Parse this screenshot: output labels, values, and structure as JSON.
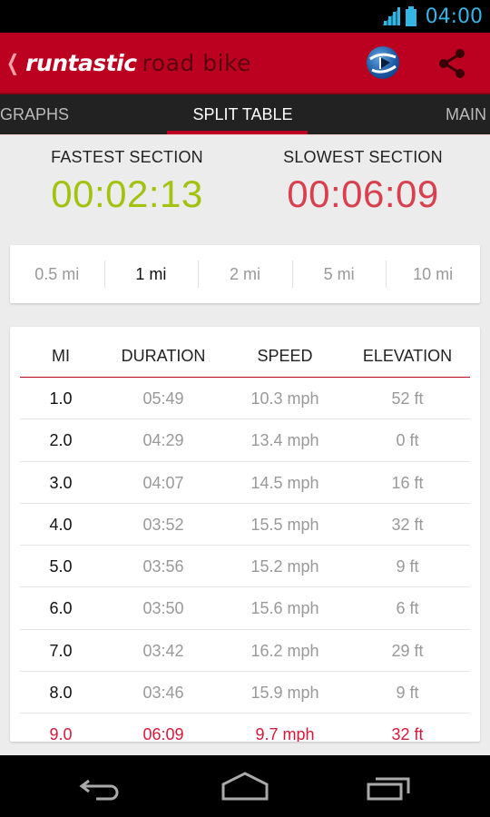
{
  "status_bar": {
    "time": "04:00",
    "icons": [
      "signal-icon",
      "battery-icon"
    ],
    "accent_color": "#33b5e5"
  },
  "action_bar": {
    "back_icon": "chevron-left-icon",
    "brand": "runtastic",
    "product": "road bike",
    "icons": [
      "runtastic-app-icon",
      "share-icon"
    ],
    "color": "#bb0020"
  },
  "tabs": [
    {
      "label": "GRAPHS",
      "active": false
    },
    {
      "label": "SPLIT TABLE",
      "active": true
    },
    {
      "label": "MAIN",
      "active": false
    }
  ],
  "summary": {
    "fastest": {
      "label": "FASTEST SECTION",
      "value": "00:02:13",
      "color": "#a2c20e"
    },
    "slowest": {
      "label": "SLOWEST SECTION",
      "value": "00:06:09",
      "color": "#d8404f"
    }
  },
  "intervals": [
    {
      "label": "0.5 mi",
      "active": false
    },
    {
      "label": "1 mi",
      "active": true
    },
    {
      "label": "2 mi",
      "active": false
    },
    {
      "label": "5 mi",
      "active": false
    },
    {
      "label": "10 mi",
      "active": false
    }
  ],
  "split_table": {
    "headers": [
      "MI",
      "DURATION",
      "SPEED",
      "ELEVATION"
    ],
    "rows": [
      [
        "1.0",
        "05:49",
        "10.3 mph",
        "52 ft"
      ],
      [
        "2.0",
        "04:29",
        "13.4 mph",
        "0 ft"
      ],
      [
        "3.0",
        "04:07",
        "14.5 mph",
        "16 ft"
      ],
      [
        "4.0",
        "03:52",
        "15.5 mph",
        "32 ft"
      ],
      [
        "5.0",
        "03:56",
        "15.2 mph",
        "9 ft"
      ],
      [
        "6.0",
        "03:50",
        "15.6 mph",
        "6 ft"
      ],
      [
        "7.0",
        "03:42",
        "16.2 mph",
        "29 ft"
      ],
      [
        "8.0",
        "03:46",
        "15.9 mph",
        "9 ft"
      ],
      [
        "9.0",
        "06:09",
        "9.7 mph",
        "32 ft"
      ]
    ],
    "highlight_row_index": 8,
    "highlight_color": "#d8183a"
  },
  "nav_bar": {
    "icons": [
      "back-icon",
      "home-icon",
      "recent-apps-icon"
    ]
  }
}
